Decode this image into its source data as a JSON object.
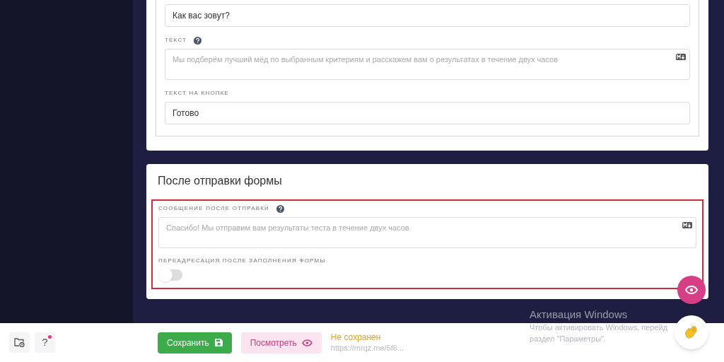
{
  "form_fields": [
    {
      "kind": "input",
      "value": "Как вас зовут?"
    },
    {
      "kind": "textarea",
      "label": "ТЕКСТ",
      "help": true,
      "placeholder": "Мы подберём лучший мёд по выбранным критериям и расскажем вам о результатах в течение двух часов"
    },
    {
      "kind": "input",
      "label": "ТЕКСТ НА КНОПКЕ",
      "value": "Готово"
    }
  ],
  "after_submit": {
    "title": "После отправки формы",
    "highlighted": true,
    "message": {
      "label": "СООБЩЕНИЕ ПОСЛЕ ОТПРАВКИ",
      "help": true,
      "placeholder": "Спасибо! Мы отправим вам результаты теста в течение двух часов"
    },
    "redirect": {
      "label": "ПЕРЕАДРЕСАЦИЯ ПОСЛЕ ЗАПОЛНЕНИЯ ФОРМЫ",
      "on": false
    }
  },
  "bottom_bar": {
    "help_button": "?",
    "help_badge": true,
    "save_button": "Сохранить",
    "preview_button": "Посмотреть",
    "status": "Не сохранен",
    "url": "https://mrqz.me/5f6..."
  },
  "os_notice": {
    "title": "Активация Windows",
    "text": "Чтобы активировать Windows, перейд",
    "text_2": "раздел \"Параметры\"."
  }
}
